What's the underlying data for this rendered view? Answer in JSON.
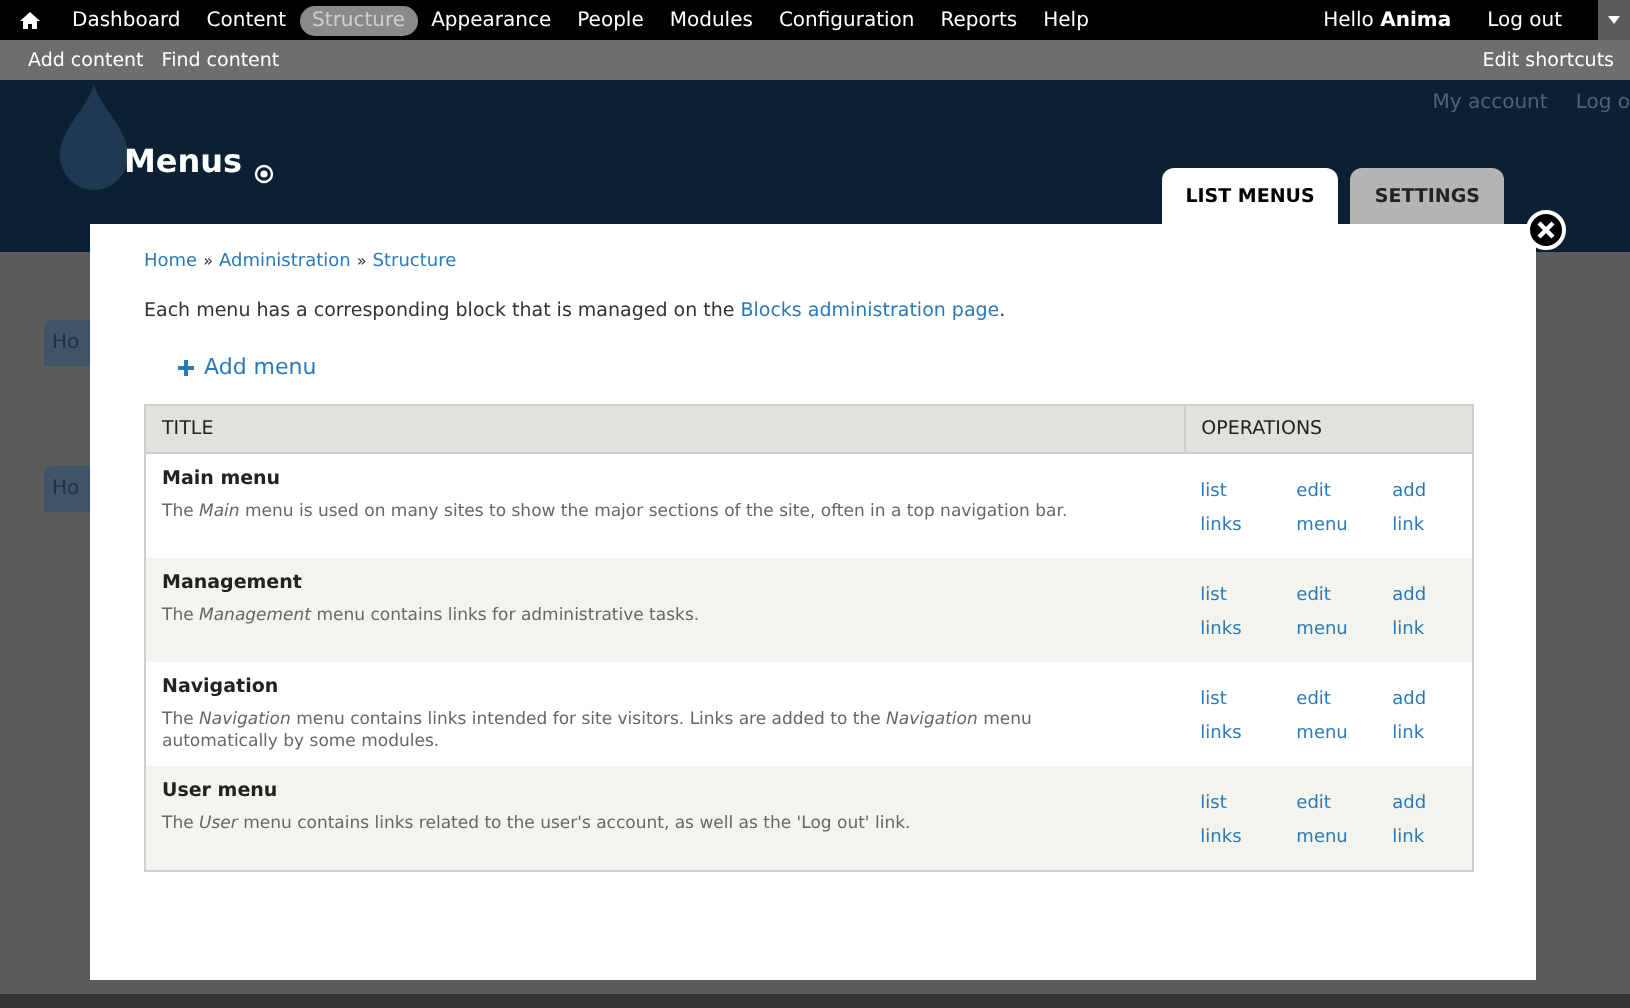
{
  "toolbar": {
    "items": [
      {
        "label": "Dashboard",
        "selected": false
      },
      {
        "label": "Content",
        "selected": false
      },
      {
        "label": "Structure",
        "selected": true
      },
      {
        "label": "Appearance",
        "selected": false
      },
      {
        "label": "People",
        "selected": false
      },
      {
        "label": "Modules",
        "selected": false
      },
      {
        "label": "Configuration",
        "selected": false
      },
      {
        "label": "Reports",
        "selected": false
      },
      {
        "label": "Help",
        "selected": false
      }
    ],
    "greeting": "Hello **Anima**",
    "logout": "Log out"
  },
  "shortcuts": {
    "items": [
      "Add content",
      "Find content"
    ],
    "edit": "Edit shortcuts"
  },
  "background": {
    "account_links": [
      "My account",
      "Log o"
    ],
    "tabs": [
      "Ho",
      "Ho"
    ]
  },
  "overlay": {
    "title": "Menus",
    "tabs": [
      {
        "label": "LIST MENUS",
        "selected": true
      },
      {
        "label": "SETTINGS",
        "selected": false
      }
    ],
    "breadcrumb": [
      "Home",
      "Administration",
      "Structure"
    ],
    "separator": "»",
    "intro": {
      "before": "Each menu has a corresponding block that is managed on the ",
      "link": "Blocks administration page",
      "after": "."
    },
    "add_action": "Add menu",
    "table": {
      "columns": [
        "TITLE",
        "OPERATIONS"
      ],
      "rows": [
        {
          "title": "Main menu",
          "description": "The *Main* menu is used on many sites to show the major sections of the site, often in a top navigation bar.",
          "operations": [
            "list links",
            "edit menu",
            "add link"
          ]
        },
        {
          "title": "Management",
          "description": "The *Management* menu contains links for administrative tasks.",
          "operations": [
            "list links",
            "edit menu",
            "add link"
          ]
        },
        {
          "title": "Navigation",
          "description": "The *Navigation* menu contains links intended for site visitors. Links are added to the *Navigation* menu automatically by some modules.",
          "operations": [
            "list links",
            "edit menu",
            "add link"
          ]
        },
        {
          "title": "User menu",
          "description": "The *User* menu contains links related to the user's account, as well as the 'Log out' link.",
          "operations": [
            "list links",
            "edit menu",
            "add link"
          ]
        }
      ]
    }
  }
}
